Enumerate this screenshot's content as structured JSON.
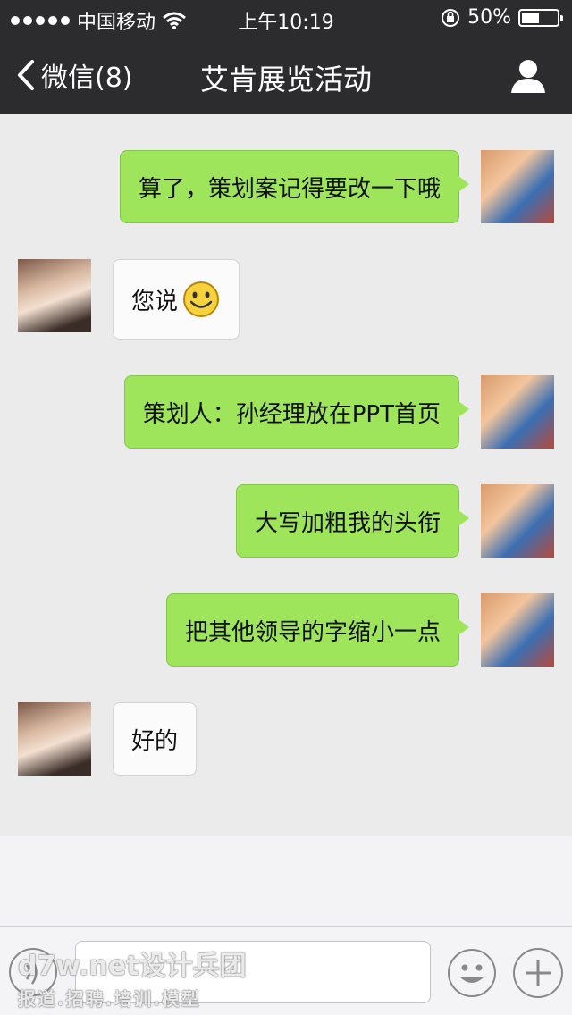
{
  "status_bar": {
    "carrier": "中国移动",
    "time": "上午10:19",
    "battery_percent": "50%",
    "battery_level": 0.5
  },
  "nav": {
    "back_label": "微信(8)",
    "title": "艾肯展览活动",
    "profile_icon": "person-icon"
  },
  "messages": [
    {
      "sender": "me",
      "text": "算了，策划案记得要改一下哦"
    },
    {
      "sender": "other",
      "text": "您说",
      "emoji": "smiley"
    },
    {
      "sender": "me",
      "text": "策划人：孙经理放在PPT首页"
    },
    {
      "sender": "me",
      "text": "大写加粗我的头衔"
    },
    {
      "sender": "me",
      "text": "把其他领导的字缩小一点"
    },
    {
      "sender": "other",
      "text": "好的"
    }
  ],
  "input_bar": {
    "voice_icon": "voice-icon",
    "emoji_icon": "emoji-icon",
    "plus_icon": "plus-icon"
  },
  "watermark": {
    "line1": "d7w.net设计兵团",
    "line2": "报道.招聘.培训.模型"
  },
  "colors": {
    "nav_bg": "#2c2c2e",
    "chat_bg": "#ebebeb",
    "my_bubble": "#9fe55b",
    "other_bubble": "#fbfbfb"
  }
}
